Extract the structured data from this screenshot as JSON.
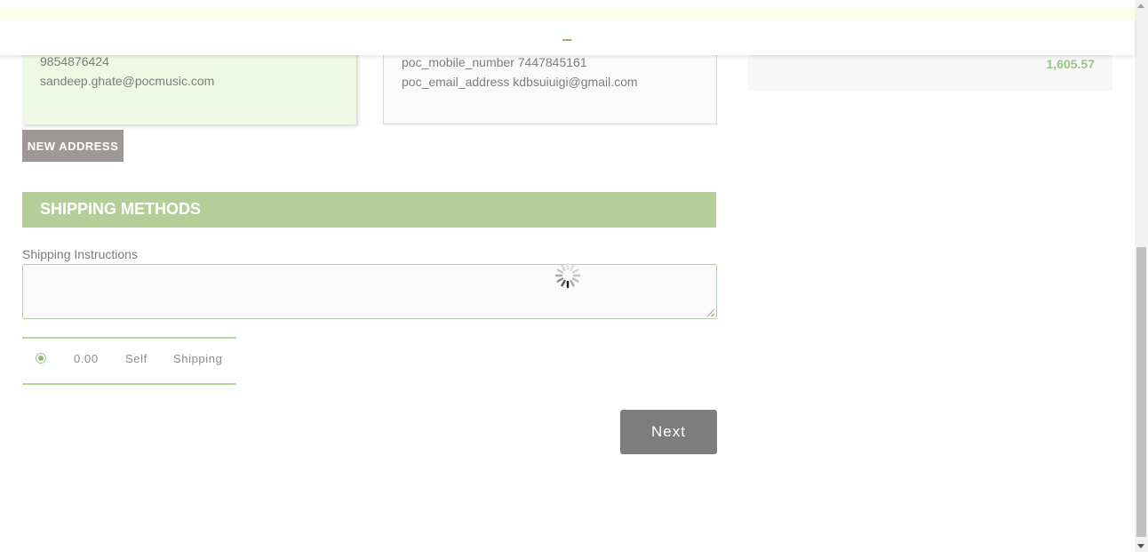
{
  "billing_address": {
    "phone": "9854876424",
    "email": "sandeep.ghate@pocmusic.com"
  },
  "shipping_address": {
    "mobile": "poc_mobile_number 7447845161",
    "email": "poc_email_address kdbsuiuigi@gmail.com"
  },
  "order_summary": {
    "total": "1,605.57"
  },
  "buttons": {
    "new_address": "NEW ADDRESS",
    "next": "Next"
  },
  "shipping_methods": {
    "title": "SHIPPING METHODS",
    "instructions_label": "Shipping Instructions",
    "instructions_value": "",
    "options": [
      {
        "price": "0.00",
        "name_part1": "Self",
        "name_part2": "Shipping",
        "selected": true
      }
    ]
  },
  "colors": {
    "accent_green": "#b5ce97",
    "card_green": "#eef8e2",
    "button_gray": "#7d7d7d"
  },
  "icons": [
    "loading-spinner-icon",
    "radio-selected-icon",
    "scroll-up-arrow-icon",
    "scroll-down-arrow-icon"
  ]
}
